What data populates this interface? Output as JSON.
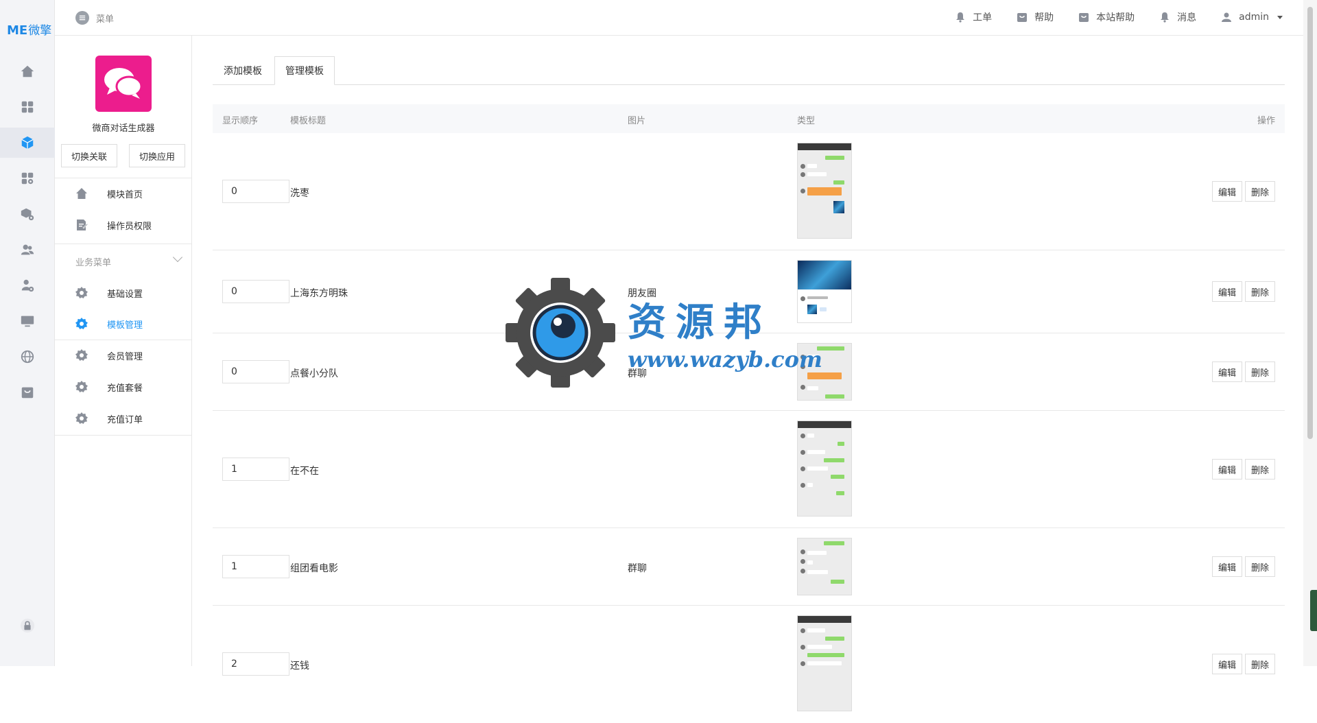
{
  "brand": {
    "logo_mark": "ME",
    "logo_text": "微擎"
  },
  "colors": {
    "accent": "#2196f3",
    "app_icon_bg": "#ec1d8d",
    "chat_green": "#8fd96b",
    "chat_orange": "#f5a047"
  },
  "rail": {
    "icons": [
      "home-icon",
      "apps-grid-icon",
      "cube-icon",
      "apps-settings-icon",
      "box-settings-icon",
      "users-icon",
      "user-settings-icon",
      "monitor-icon",
      "globe-icon",
      "bag-icon"
    ],
    "bottom_icon": "lock-icon",
    "active_index": 2
  },
  "header": {
    "menu_label": "菜单",
    "nav": [
      {
        "icon": "bell-icon",
        "label": "工单"
      },
      {
        "icon": "bag-icon",
        "label": "帮助"
      },
      {
        "icon": "bag-icon",
        "label": "本站帮助"
      },
      {
        "icon": "bell-icon",
        "label": "消息"
      },
      {
        "icon": "user-icon",
        "label": "admin"
      }
    ]
  },
  "sidebar": {
    "app_name": "微商对话生成器",
    "switch_link": "切换关联",
    "switch_app": "切换应用",
    "top_items": [
      {
        "icon": "home-icon",
        "label": "模块首页"
      },
      {
        "icon": "edit-doc-icon",
        "label": "操作员权限"
      }
    ],
    "group_title": "业务菜单",
    "group_items": [
      {
        "icon": "gear-icon",
        "label": "基础设置"
      },
      {
        "icon": "gear-icon",
        "label": "模板管理"
      },
      {
        "icon": "gear-icon",
        "label": "会员管理"
      },
      {
        "icon": "gear-icon",
        "label": "充值套餐"
      },
      {
        "icon": "gear-icon",
        "label": "充值订单"
      }
    ],
    "active_item": "模板管理"
  },
  "tabs": [
    {
      "label": "添加模板",
      "active": false
    },
    {
      "label": "管理模板",
      "active": true
    }
  ],
  "table": {
    "columns": [
      "显示顺序",
      "模板标题",
      "图片",
      "类型",
      "操作"
    ],
    "rows": [
      {
        "order": "0",
        "title": "洗枣",
        "type": "",
        "edit": "编辑",
        "delete": "删除"
      },
      {
        "order": "0",
        "title": "上海东方明珠",
        "type": "朋友圈",
        "edit": "编辑",
        "delete": "删除"
      },
      {
        "order": "0",
        "title": "点餐小分队",
        "type": "群聊",
        "edit": "编辑",
        "delete": "删除"
      },
      {
        "order": "1",
        "title": "在不在",
        "type": "",
        "edit": "编辑",
        "delete": "删除"
      },
      {
        "order": "1",
        "title": "组团看电影",
        "type": "群聊",
        "edit": "编辑",
        "delete": "删除"
      },
      {
        "order": "2",
        "title": "还钱",
        "type": "",
        "edit": "编辑",
        "delete": "删除"
      }
    ]
  },
  "watermark": {
    "title": "资源邦",
    "url": "www.wazyb.com"
  }
}
